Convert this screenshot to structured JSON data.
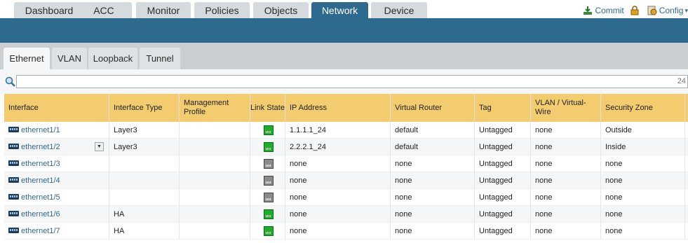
{
  "nav": {
    "tabs": [
      {
        "label": "Dashboard"
      },
      {
        "label": "ACC"
      },
      {
        "label": "Monitor"
      },
      {
        "label": "Policies"
      },
      {
        "label": "Objects"
      },
      {
        "label": "Network"
      },
      {
        "label": "Device"
      }
    ],
    "active": "Network",
    "commit_label": "Commit",
    "config_label": "Config"
  },
  "subtabs": [
    {
      "label": "Ethernet"
    },
    {
      "label": "VLAN"
    },
    {
      "label": "Loopback"
    },
    {
      "label": "Tunnel"
    }
  ],
  "filter": {
    "value": "",
    "count": "24"
  },
  "table": {
    "columns": [
      "Interface",
      "Interface Type",
      "Management Profile",
      "Link State",
      "IP Address",
      "Virtual Router",
      "Tag",
      "VLAN / Virtual-Wire",
      "Security Zone"
    ],
    "rows": [
      {
        "interface": "ethernet1/1",
        "type": "Layer3",
        "mgmt": "",
        "link": "up",
        "ip": "1.1.1.1_24",
        "vr": "default",
        "tag": "Untagged",
        "vlan": "none",
        "zone": "Outside"
      },
      {
        "interface": "ethernet1/2",
        "type": "Layer3",
        "mgmt": "",
        "link": "up",
        "ip": "2.2.2.1_24",
        "vr": "default",
        "tag": "Untagged",
        "vlan": "none",
        "zone": "Inside"
      },
      {
        "interface": "ethernet1/3",
        "type": "",
        "mgmt": "",
        "link": "down",
        "ip": "none",
        "vr": "none",
        "tag": "Untagged",
        "vlan": "none",
        "zone": "none"
      },
      {
        "interface": "ethernet1/4",
        "type": "",
        "mgmt": "",
        "link": "down",
        "ip": "none",
        "vr": "none",
        "tag": "Untagged",
        "vlan": "none",
        "zone": "none"
      },
      {
        "interface": "ethernet1/5",
        "type": "",
        "mgmt": "",
        "link": "down",
        "ip": "none",
        "vr": "none",
        "tag": "Untagged",
        "vlan": "none",
        "zone": "none"
      },
      {
        "interface": "ethernet1/6",
        "type": "HA",
        "mgmt": "",
        "link": "up",
        "ip": "none",
        "vr": "none",
        "tag": "Untagged",
        "vlan": "none",
        "zone": "none"
      },
      {
        "interface": "ethernet1/7",
        "type": "HA",
        "mgmt": "",
        "link": "up",
        "ip": "none",
        "vr": "none",
        "tag": "Untagged",
        "vlan": "none",
        "zone": "none"
      }
    ]
  },
  "colors": {
    "brand": "#2e6a8e",
    "header": "#f2cc6e",
    "link_up": "#1fae2b",
    "link_down": "#8a8a8a"
  }
}
